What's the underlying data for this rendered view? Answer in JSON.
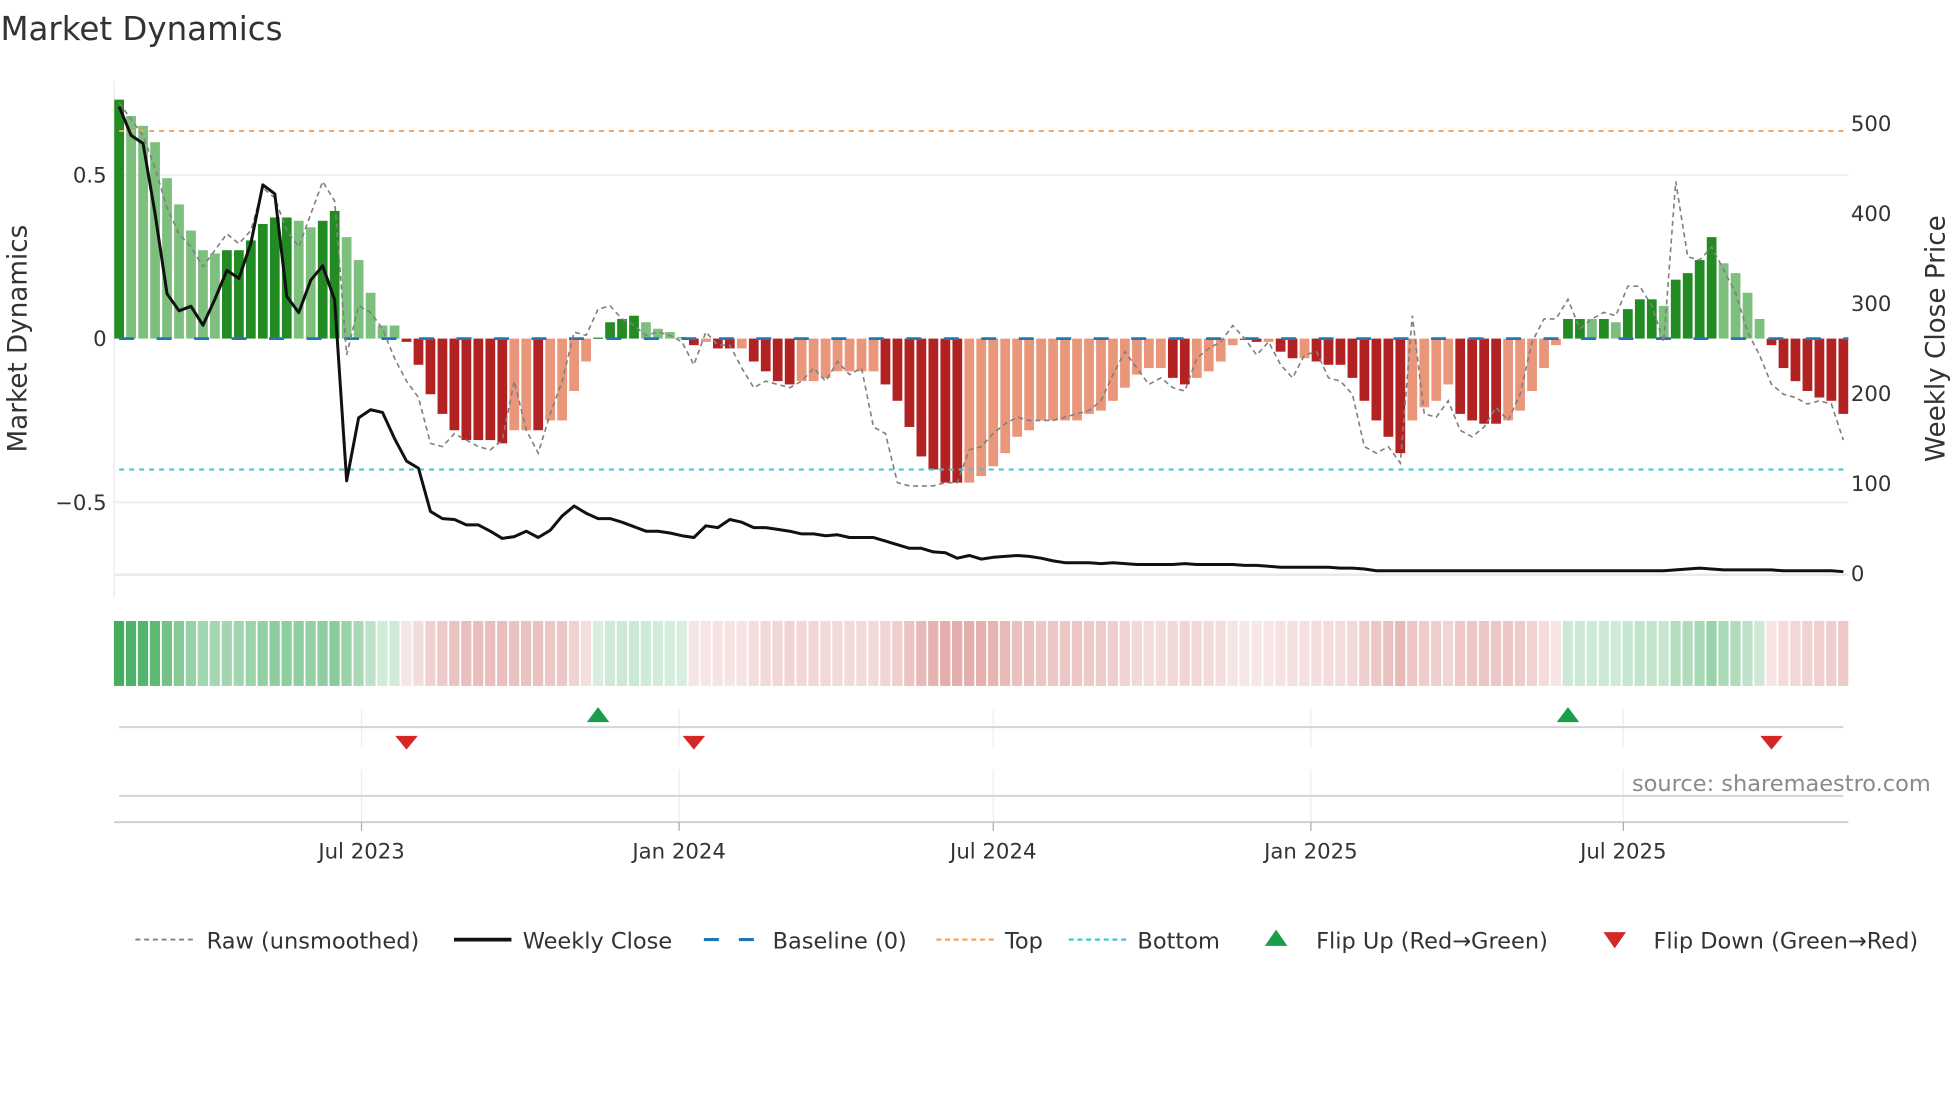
{
  "chart_data": {
    "type": "bar",
    "title": "Market Dynamics",
    "ylabel": "Market Dynamics",
    "y2label": "Weekly Close Price",
    "ylim": [
      -0.72,
      0.74
    ],
    "y2lim": [
      0,
      520
    ],
    "yticks": [
      {
        "v": 0.5,
        "label": "0.5"
      },
      {
        "v": 0,
        "label": "0"
      },
      {
        "v": -0.5,
        "label": "−0.5"
      }
    ],
    "y2ticks": [
      {
        "v": 500,
        "label": "500"
      },
      {
        "v": 400,
        "label": "400"
      },
      {
        "v": 300,
        "label": "300"
      },
      {
        "v": 200,
        "label": "200"
      },
      {
        "v": 100,
        "label": "100"
      },
      {
        "v": 0,
        "label": "0"
      }
    ],
    "xticks": [
      {
        "date": "2023-07-01",
        "label": "Jul 2023"
      },
      {
        "date": "2024-01-01",
        "label": "Jan 2024"
      },
      {
        "date": "2024-07-01",
        "label": "Jul 2024"
      },
      {
        "date": "2025-01-01",
        "label": "Jan 2025"
      },
      {
        "date": "2025-07-01",
        "label": "Jul 2025"
      }
    ],
    "frequency": "weekly",
    "top_threshold": 0.634,
    "bottom_threshold": -0.4,
    "baseline": 0,
    "values": [
      0.73,
      0.68,
      0.65,
      0.6,
      0.49,
      0.41,
      0.33,
      0.27,
      0.26,
      0.27,
      0.27,
      0.3,
      0.35,
      0.37,
      0.37,
      0.36,
      0.34,
      0.36,
      0.39,
      0.31,
      0.24,
      0.14,
      0.04,
      0.04,
      -0.01,
      -0.08,
      -0.17,
      -0.23,
      -0.28,
      -0.31,
      -0.31,
      -0.31,
      -0.32,
      -0.28,
      -0.28,
      -0.28,
      -0.25,
      -0.25,
      -0.16,
      -0.07,
      0.003,
      0.05,
      0.06,
      0.07,
      0.05,
      0.03,
      0.02,
      0.005,
      -0.02,
      -0.01,
      -0.03,
      -0.03,
      -0.03,
      -0.07,
      -0.1,
      -0.13,
      -0.14,
      -0.13,
      -0.13,
      -0.12,
      -0.1,
      -0.1,
      -0.1,
      -0.1,
      -0.14,
      -0.19,
      -0.27,
      -0.36,
      -0.4,
      -0.44,
      -0.44,
      -0.44,
      -0.42,
      -0.39,
      -0.35,
      -0.3,
      -0.28,
      -0.25,
      -0.25,
      -0.25,
      -0.25,
      -0.23,
      -0.22,
      -0.19,
      -0.15,
      -0.11,
      -0.09,
      -0.09,
      -0.12,
      -0.14,
      -0.12,
      -0.1,
      -0.07,
      -0.02,
      -0.003,
      -0.01,
      -0.01,
      -0.04,
      -0.06,
      -0.06,
      -0.07,
      -0.08,
      -0.08,
      -0.12,
      -0.19,
      -0.25,
      -0.3,
      -0.35,
      -0.25,
      -0.21,
      -0.19,
      -0.14,
      -0.23,
      -0.25,
      -0.26,
      -0.26,
      -0.25,
      -0.22,
      -0.16,
      -0.09,
      -0.02,
      0.06,
      0.06,
      0.06,
      0.06,
      0.05,
      0.09,
      0.12,
      0.12,
      0.1,
      0.18,
      0.2,
      0.24,
      0.31,
      0.23,
      0.2,
      0.14,
      0.06,
      -0.02,
      -0.09,
      -0.13,
      -0.16,
      -0.18,
      -0.19,
      -0.23
    ],
    "strength": "DLLLLLLLLDDDDDDLLDDLLLLLDDDDDDDDDLLDLLLLDDDDLLLLDLDDLDDDDLLLLLLLDDDDDDDLLLLLLLLLLLLLLLLLDDLLLLDDLDDLDDDDDDDDLLLLDDDDLLLLLDDLDLDDDLDDDDLLLLDDDDDDD",
    "raw": [
      0.72,
      0.67,
      0.62,
      0.52,
      0.4,
      0.32,
      0.28,
      0.22,
      0.27,
      0.32,
      0.29,
      0.33,
      0.46,
      0.43,
      0.33,
      0.28,
      0.38,
      0.48,
      0.42,
      -0.05,
      0.1,
      0.08,
      0.03,
      -0.06,
      -0.13,
      -0.18,
      -0.32,
      -0.33,
      -0.29,
      -0.31,
      -0.33,
      -0.34,
      -0.31,
      -0.13,
      -0.28,
      -0.35,
      -0.23,
      -0.13,
      0.02,
      0.01,
      0.09,
      0.1,
      0.06,
      0.04,
      0.01,
      0.02,
      0.01,
      -0.01,
      -0.08,
      0.02,
      -0.02,
      -0.02,
      -0.09,
      -0.15,
      -0.13,
      -0.14,
      -0.15,
      -0.13,
      -0.09,
      -0.13,
      -0.07,
      -0.11,
      -0.09,
      -0.27,
      -0.29,
      -0.44,
      -0.45,
      -0.45,
      -0.45,
      -0.44,
      -0.44,
      -0.34,
      -0.33,
      -0.29,
      -0.26,
      -0.24,
      -0.25,
      -0.25,
      -0.25,
      -0.24,
      -0.23,
      -0.22,
      -0.19,
      -0.11,
      -0.04,
      -0.09,
      -0.14,
      -0.12,
      -0.15,
      -0.16,
      -0.06,
      -0.03,
      -0.01,
      0.04,
      0.0,
      -0.05,
      -0.01,
      -0.08,
      -0.12,
      -0.05,
      -0.04,
      -0.12,
      -0.13,
      -0.17,
      -0.33,
      -0.35,
      -0.33,
      -0.38,
      0.07,
      -0.23,
      -0.24,
      -0.19,
      -0.28,
      -0.3,
      -0.27,
      -0.21,
      -0.25,
      -0.17,
      -0.01,
      0.06,
      0.06,
      0.12,
      0.03,
      0.06,
      0.08,
      0.07,
      0.16,
      0.16,
      0.1,
      -0.01,
      0.48,
      0.25,
      0.24,
      0.28,
      0.21,
      0.14,
      0.02,
      -0.05,
      -0.14,
      -0.17,
      -0.18,
      -0.2,
      -0.19,
      -0.2,
      -0.31
    ],
    "close": [
      519,
      487,
      478,
      400,
      311,
      292,
      297,
      276,
      305,
      337,
      328,
      367,
      432,
      422,
      308,
      290,
      326,
      342,
      304,
      103,
      173,
      182,
      179,
      150,
      125,
      117,
      69,
      61,
      60,
      54,
      54,
      47,
      39,
      41,
      47,
      40,
      48,
      64,
      75,
      67,
      61,
      61,
      57,
      52,
      47,
      47,
      45,
      42,
      40,
      53,
      51,
      60,
      57,
      51,
      51,
      49,
      47,
      44,
      44,
      42,
      43,
      40,
      40,
      40,
      36,
      32,
      28,
      28,
      24,
      23,
      17,
      20,
      16,
      18,
      19,
      20,
      19,
      17,
      14,
      12,
      12,
      12,
      11,
      12,
      11,
      10,
      10,
      10,
      10,
      11,
      10,
      10,
      10,
      10,
      9,
      9,
      8,
      7,
      7,
      7,
      7,
      7,
      6,
      6,
      5,
      3,
      3,
      3,
      3,
      3,
      3,
      3,
      3,
      3,
      3,
      3,
      3,
      3,
      3,
      3,
      3,
      3,
      3,
      3,
      3,
      3,
      3,
      3,
      3,
      3,
      4,
      5,
      6,
      5,
      4,
      4,
      4,
      4,
      4,
      3,
      3,
      3,
      3,
      3,
      2
    ],
    "flips": [
      {
        "index": 24,
        "dir": "down"
      },
      {
        "index": 40,
        "dir": "up"
      },
      {
        "index": 48,
        "dir": "down"
      },
      {
        "index": 121,
        "dir": "up"
      },
      {
        "index": 138,
        "dir": "down"
      }
    ],
    "legend": {
      "placement": "bottom",
      "items": [
        {
          "key": "raw",
          "label": "Raw (unsmoothed)"
        },
        {
          "key": "close",
          "label": "Weekly Close"
        },
        {
          "key": "baseline",
          "label": "Baseline (0)"
        },
        {
          "key": "top",
          "label": "Top"
        },
        {
          "key": "bottom",
          "label": "Bottom"
        },
        {
          "key": "flipup",
          "label": "Flip Up (Red→Green)"
        },
        {
          "key": "flipdown",
          "label": "Flip Down (Green→Red)"
        }
      ]
    },
    "source": "source: sharemaestro.com",
    "colors": {
      "green_strong": "#228b22",
      "green_weak": "#7dbf7d",
      "red_strong": "#b22222",
      "red_weak": "#e9967a",
      "raw": "#808080",
      "close": "#111111",
      "baseline": "#1f77b4",
      "top": "#f4a460",
      "bottom": "#3ec5d8",
      "flip_up": "#1a9e4a",
      "flip_down": "#d62728",
      "strip_green": "#3aa857",
      "strip_red": "#c9625c"
    }
  }
}
